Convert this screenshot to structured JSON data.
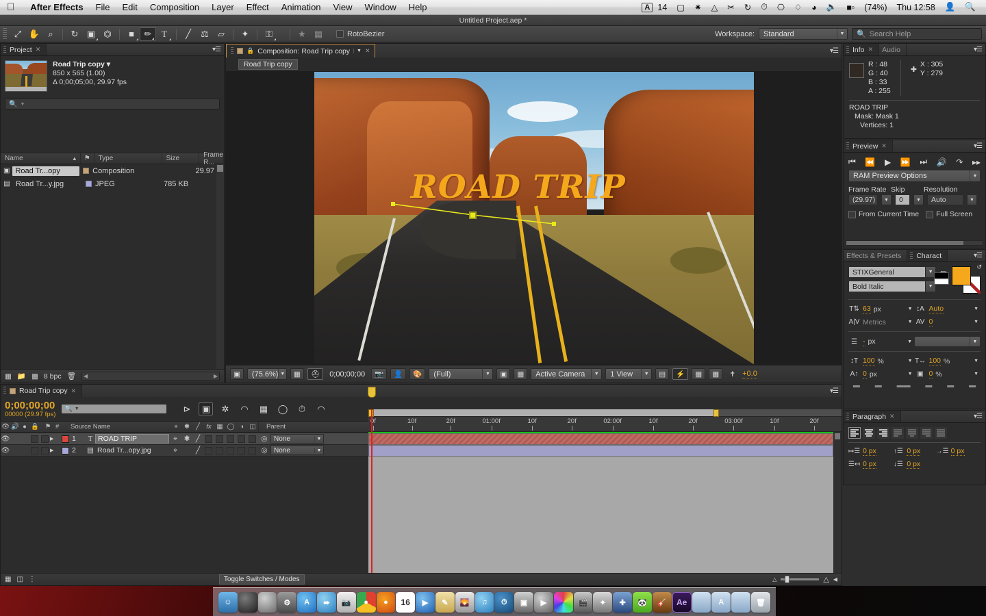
{
  "menubar": {
    "apple_icon": "apple-icon",
    "items": [
      {
        "label": "After Effects",
        "bold": true
      },
      {
        "label": "File"
      },
      {
        "label": "Edit"
      },
      {
        "label": "Composition"
      },
      {
        "label": "Layer"
      },
      {
        "label": "Effect"
      },
      {
        "label": "Animation"
      },
      {
        "label": "View"
      },
      {
        "label": "Window"
      },
      {
        "label": "Help"
      }
    ],
    "status": {
      "adobe_badge": "A",
      "adobe_count": "14",
      "dropbox_icon": "dropbox-icon",
      "spotlight_small": "sparkle-icon",
      "droplet_icon": "droplet-icon",
      "scissors_icon": "shears-icon",
      "sync_icon": "sync-icon",
      "clock_icon": "clock-icon",
      "display_icon": "display-icon",
      "bluetooth_icon": "bluetooth-icon",
      "wifi_icon": "wifi-icon",
      "volume_icon": "volume-icon",
      "battery_icon": "battery-icon",
      "battery_pct": "(74%)",
      "clock": "Thu 12:58",
      "user_icon": "user-icon",
      "search_icon": "spotlight-search-icon"
    }
  },
  "titlebar": {
    "title": "Untitled Project.aep *"
  },
  "toolbar": {
    "tools": [
      {
        "name": "selection-tool",
        "glyph": "↖",
        "active": false
      },
      {
        "name": "hand-tool",
        "glyph": "✋",
        "active": false
      },
      {
        "name": "zoom-tool",
        "glyph": "⌕",
        "active": false
      },
      {
        "name": "rotation-tool",
        "glyph": "↻",
        "active": false
      },
      {
        "name": "camera-tool",
        "glyph": "Ἲ5",
        "active": false
      },
      {
        "name": "pan-behind-tool",
        "glyph": "⌘",
        "active": false
      },
      {
        "name": "shape-tool",
        "glyph": "■",
        "active": false
      },
      {
        "name": "pen-tool",
        "glyph": "✒",
        "active": true
      },
      {
        "name": "type-tool",
        "glyph": "T",
        "active": false
      },
      {
        "name": "brush-tool",
        "glyph": "╱",
        "active": false
      },
      {
        "name": "clone-stamp-tool",
        "glyph": "⚑",
        "active": false
      },
      {
        "name": "eraser-tool",
        "glyph": "▱",
        "active": false
      },
      {
        "name": "roto-brush-tool",
        "glyph": "✦",
        "active": false
      },
      {
        "name": "puppet-pin-tool",
        "glyph": "⚑",
        "active": false
      }
    ],
    "rotobezier_label": "RotoBezier",
    "rotobezier_checked": false,
    "workspace_label": "Workspace:",
    "workspace_value": "Standard",
    "search_placeholder": "Search Help"
  },
  "project": {
    "tab_label": "Project",
    "comp_name": "Road Trip copy",
    "comp_size": "850 x 565 (1.00)",
    "comp_duration": "Δ 0;00;05;00, 29.97 fps",
    "search_placeholder": "",
    "columns": [
      "Name",
      "Type",
      "Size",
      "Frame R..."
    ],
    "rows": [
      {
        "name": "Road Tr...opy",
        "type": "Composition",
        "size": "",
        "framerate": "29.97",
        "swatch": "#c4a478",
        "selected": true,
        "icon": "composition-icon"
      },
      {
        "name": "Road Tr...y.jpg",
        "type": "JPEG",
        "size": "785 KB",
        "framerate": "",
        "swatch": "#a8a8d8",
        "selected": false,
        "icon": "jpeg-icon"
      }
    ],
    "footer": {
      "bpc": "8 bpc"
    }
  },
  "composition": {
    "tab_label": "Composition: Road Trip copy",
    "breadcrumb": "Road Trip copy",
    "artwork_title": "ROAD TRIP",
    "footer": {
      "magnification": "(75.6%)",
      "timecode": "0;00;00;00",
      "resolution": "(Full)",
      "camera": "Active Camera",
      "views": "1 View",
      "exposure": "+0.0"
    }
  },
  "info": {
    "tabs": [
      "Info",
      "Audio"
    ],
    "active_tab": "Info",
    "r": "R : 48",
    "g": "G : 40",
    "b": "B : 33",
    "a": "A : 255",
    "x": "X : 305",
    "y": "Y : 279",
    "layer_name": "ROAD TRIP",
    "mask": "Mask: Mask 1",
    "vertices": "Vertices: 1",
    "color_hex": "#302821"
  },
  "preview": {
    "tab_label": "Preview",
    "buttons": [
      {
        "name": "first-frame-button",
        "glyph": "⏮"
      },
      {
        "name": "previous-frame-button",
        "glyph": "◁"
      },
      {
        "name": "play-button",
        "glyph": "▶"
      },
      {
        "name": "next-frame-button",
        "glyph": "▷"
      },
      {
        "name": "last-frame-button",
        "glyph": "⏭"
      },
      {
        "name": "audio-toggle-button",
        "glyph": "ὐa"
      },
      {
        "name": "loop-button",
        "glyph": "↺"
      },
      {
        "name": "ram-preview-button",
        "glyph": "▶‖"
      }
    ],
    "ram_options": "RAM Preview Options",
    "labels": {
      "frame_rate": "Frame Rate",
      "skip": "Skip",
      "resolution": "Resolution"
    },
    "frame_rate": "(29.97)",
    "skip": "0",
    "resolution": "Auto",
    "from_current_time": "From Current Time",
    "from_current_time_checked": false,
    "full_screen": "Full Screen",
    "full_screen_checked": false
  },
  "character": {
    "tabs": [
      "Effects & Presets",
      "Charact"
    ],
    "active_tab": "Charact",
    "font_family": "STIXGeneral",
    "font_style": "Bold Italic",
    "fill_color": "#f5a81c",
    "stroke_color": "#ffffff",
    "font_size": "63",
    "font_size_unit": "px",
    "leading": "Auto",
    "kerning": "Metrics",
    "tracking": "0",
    "stroke_width": "-",
    "stroke_width_unit": "px",
    "vertical_scale": "100",
    "horizontal_scale": "100",
    "vertical_scale_unit": "%",
    "horizontal_scale_unit": "%",
    "baseline_shift": "0",
    "baseline_shift_unit": "px",
    "tsume": "0",
    "tsume_unit": "%"
  },
  "paragraph": {
    "tab_label": "Paragraph",
    "indent_left": "0 px",
    "indent_right": "0 px",
    "indent_first": "0 px",
    "space_before": "0 px",
    "space_after": "0 px"
  },
  "timeline": {
    "tab_label": "Road Trip copy",
    "current_time": "0;00;00;00",
    "frames": "00000 (29.97 fps)",
    "search_placeholder": "",
    "columns": {
      "number": "#",
      "source_name": "Source Name",
      "parent": "Parent"
    },
    "layers": [
      {
        "index": "1",
        "name": "ROAD TRIP",
        "label_color": "#d9463e",
        "parent": "None",
        "type": "text",
        "bar_color": "#c46a64",
        "selected": true
      },
      {
        "index": "2",
        "name": "Road Tr...opy.jpg",
        "label_color": "#a8a8d8",
        "parent": "None",
        "type": "footage",
        "bar_color": "#a0a0c8",
        "selected": false
      }
    ],
    "ruler_labels": [
      "0f",
      "10f",
      "20f",
      "01:00f",
      "10f",
      "20f",
      "02:00f",
      "10f",
      "20f",
      "03:00f",
      "10f",
      "20f"
    ],
    "toggle_switches": "Toggle Switches / Modes"
  },
  "dock": {
    "items": [
      {
        "name": "finder",
        "color": "#3b85d0",
        "glyph": ""
      },
      {
        "name": "dashboard",
        "color": "#3a3a3a",
        "glyph": ""
      },
      {
        "name": "mission-control",
        "color": "#5a5a5a",
        "glyph": ""
      },
      {
        "name": "system-preferences",
        "color": "#6b6b6b",
        "glyph": ""
      },
      {
        "name": "app-store",
        "color": "#2f8fe0",
        "glyph": "A"
      },
      {
        "name": "safari",
        "color": "#3aa0d8",
        "glyph": ""
      },
      {
        "name": "preview",
        "color": "#d8d8d8",
        "glyph": ""
      },
      {
        "name": "chrome",
        "color": "#d94b3a",
        "glyph": ""
      },
      {
        "name": "firefox",
        "color": "#e8761f",
        "glyph": ""
      },
      {
        "name": "calendar",
        "color": "#e8e8e8",
        "glyph": "16"
      },
      {
        "name": "facetime",
        "color": "#3a7fd0",
        "glyph": ""
      },
      {
        "name": "notes",
        "color": "#e5c77a",
        "glyph": ""
      },
      {
        "name": "iphoto",
        "color": "#c8c8c8",
        "glyph": ""
      },
      {
        "name": "itunes",
        "color": "#4aa8e0",
        "glyph": ""
      },
      {
        "name": "time-machine",
        "color": "#2d6fa8",
        "glyph": ""
      },
      {
        "name": "photo-booth",
        "color": "#777",
        "glyph": ""
      },
      {
        "name": "quicktime",
        "color": "#8a8a8a",
        "glyph": ""
      },
      {
        "name": "color-picker",
        "color": "#c0c0c0",
        "glyph": ""
      },
      {
        "name": "final-cut",
        "color": "#9b9b9b",
        "glyph": ""
      },
      {
        "name": "motion",
        "color": "#b0b0b0",
        "glyph": ""
      },
      {
        "name": "compressor",
        "color": "#4a6fb0",
        "glyph": ""
      },
      {
        "name": "evernote",
        "color": "#6fd03a",
        "glyph": ""
      },
      {
        "name": "garageband",
        "color": "#8a5a2a",
        "glyph": ""
      },
      {
        "name": "after-effects",
        "color": "#2a1440",
        "glyph": "Ae"
      },
      {
        "name": "downloads-stack",
        "color": "#9db8d6",
        "glyph": ""
      },
      {
        "name": "applications-stack",
        "color": "#9db8d6",
        "glyph": ""
      },
      {
        "name": "documents-stack",
        "color": "#9db8d6",
        "glyph": ""
      },
      {
        "name": "trash",
        "color": "#c0c8cc",
        "glyph": ""
      }
    ]
  }
}
